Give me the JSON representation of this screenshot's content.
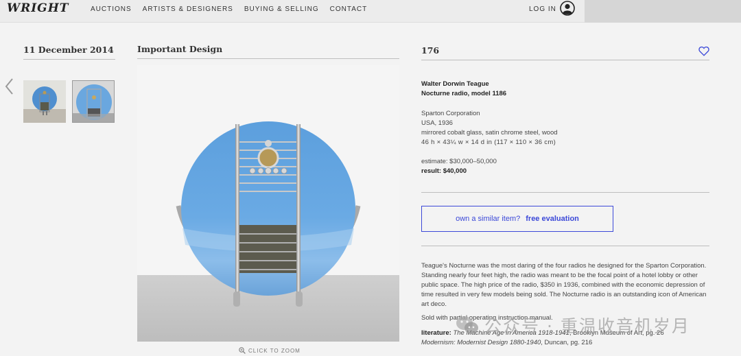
{
  "header": {
    "logo": "WRIGHT",
    "nav": [
      "AUCTIONS",
      "ARTISTS & DESIGNERS",
      "BUYING & SELLING",
      "CONTACT"
    ],
    "login": "LOG IN"
  },
  "auction": {
    "date": "11 December 2014",
    "category": "Important Design",
    "lot": "176"
  },
  "item": {
    "designer": "Walter Dorwin Teague",
    "title": "Nocturne radio, model 1186",
    "maker": "Sparton Corporation",
    "origin": "USA, 1936",
    "materials": "mirrored cobalt glass, satin chrome steel, wood",
    "dimensions": "46 h × 43¼ w × 14 d in (117 × 110 × 36 cm)",
    "estimate": "estimate: $30,000–50,000",
    "result_label": "result:",
    "result_value": "$40,000"
  },
  "evaluation": {
    "question": "own a similar item?",
    "cta": "free evaluation"
  },
  "zoom_label": "CLICK TO ZOOM",
  "description": "Teague's Nocturne was the most daring of the four radios he designed for the Sparton Corporation. Standing nearly four feet high, the radio was meant to be the focal point of a hotel lobby or other public space. The high price of the radio, $350 in 1936, combined with the economic depression of time resulted in very few models being sold. The Nocturne radio is an outstanding icon of American art deco.",
  "sold_note": "Sold with partial operating instruction manual.",
  "literature": {
    "label": "literature:",
    "ref1_title": "The Machine Age in America 1918-1941",
    "ref1_rest": ", Brooklyn Museum of Art, pg. 26",
    "ref2_title": "Modernism: Modernist Design 1880-1940",
    "ref2_rest": ", Duncan, pg. 216"
  },
  "watermark": "公众号 · 重温收音机岁月",
  "colors": {
    "accent": "#3b48d8",
    "glass_blue": "#5b9fdc",
    "background": "#f3f3f3"
  }
}
